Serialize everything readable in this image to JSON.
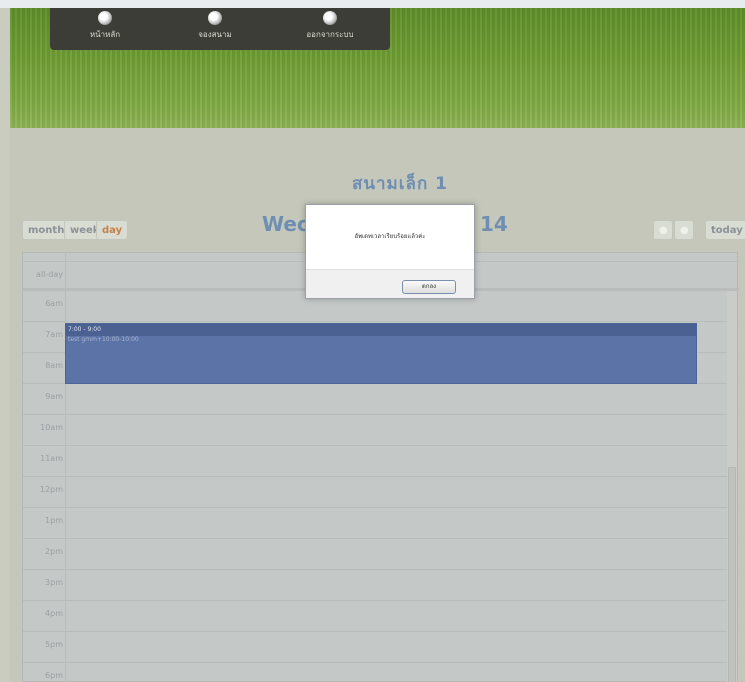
{
  "nav": {
    "items": [
      {
        "label": "หน้าหลัก",
        "icon": "soccer-ball-icon"
      },
      {
        "label": "จองสนาม",
        "icon": "soccer-ball-icon"
      },
      {
        "label": "ออกจากระบบ",
        "icon": "soccer-ball-icon"
      }
    ]
  },
  "page": {
    "title": "สนามเล็ก 1"
  },
  "toolbar": {
    "month_label": "month",
    "week_label": "week",
    "day_label": "day",
    "date_title_left": "Wec",
    "date_title_right": "14",
    "prev_icon": "circle-prev-icon",
    "next_icon": "circle-next-icon",
    "today_label": "today"
  },
  "calendar": {
    "allday_label": "all-day",
    "hours": [
      "6am",
      "7am",
      "8am",
      "9am",
      "10am",
      "11am",
      "12pm",
      "1pm",
      "2pm",
      "3pm",
      "4pm",
      "5pm",
      "6pm"
    ],
    "event": {
      "time": "7:00 - 9:00",
      "title": "test gmm+10:00-10:00"
    }
  },
  "dialog": {
    "message": "อัพเดทเวลาเรียบร้อยแล้วค่ะ",
    "ok_label": "ตกลง"
  },
  "colors": {
    "accent": "#6e8fb2",
    "active_view": "#c58048",
    "event": "#5b73a6"
  }
}
